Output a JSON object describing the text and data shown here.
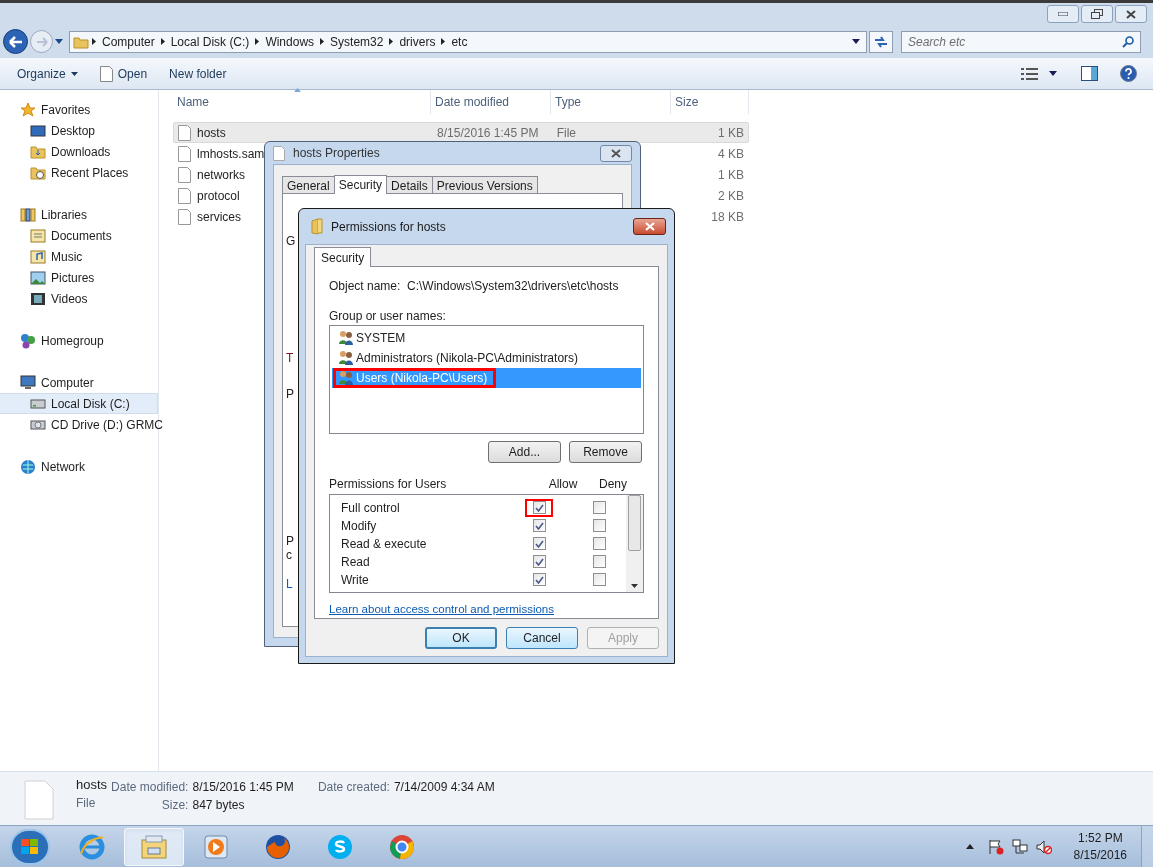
{
  "address_bar": {
    "path": [
      "Computer",
      "Local Disk (C:)",
      "Windows",
      "System32",
      "drivers",
      "etc"
    ]
  },
  "search": {
    "placeholder": "Search etc"
  },
  "toolbar": {
    "buttons": [
      {
        "label": "Organize",
        "kind": "menu"
      },
      {
        "label": "Open",
        "kind": "file"
      },
      {
        "label": "New folder",
        "kind": "plain"
      }
    ]
  },
  "sidebar": {
    "groups": [
      {
        "label": "Favorites",
        "kind": "star",
        "children": [
          {
            "label": "Desktop",
            "kind": "desktop",
            "selected": false
          },
          {
            "label": "Downloads",
            "kind": "folder",
            "selected": false
          },
          {
            "label": "Recent Places",
            "kind": "recent",
            "selected": false
          }
        ]
      },
      {
        "label": "Libraries",
        "kind": "library",
        "children": [
          {
            "label": "Documents",
            "kind": "document",
            "selected": false
          },
          {
            "label": "Music",
            "kind": "music",
            "selected": false
          },
          {
            "label": "Pictures",
            "kind": "picture",
            "selected": false
          },
          {
            "label": "Videos",
            "kind": "video",
            "selected": false
          }
        ]
      },
      {
        "label": "Homegroup",
        "kind": "homegroup"
      },
      {
        "label": "Computer",
        "kind": "computer",
        "children": [
          {
            "label": "Local Disk (C:)",
            "kind": "disk",
            "selected": true
          },
          {
            "label": "CD Drive (D:) GRMC",
            "kind": "cd",
            "selected": false
          }
        ]
      },
      {
        "label": "Network",
        "kind": "network"
      }
    ]
  },
  "file_list": {
    "columns": [
      "Name",
      "Date modified",
      "Type",
      "Size"
    ],
    "rows": [
      {
        "name": "hosts",
        "date": "8/15/2016 1:45 PM",
        "type": "File",
        "size": "1 KB",
        "selected": true
      },
      {
        "name": "lmhosts.sam",
        "size": "4 KB",
        "selected": false
      },
      {
        "name": "networks",
        "size": "1 KB",
        "selected": false
      },
      {
        "name": "protocol",
        "size": "2 KB",
        "selected": false
      },
      {
        "name": "services",
        "size": "18 KB",
        "selected": false
      }
    ]
  },
  "properties_dialog": {
    "title": "hosts Properties",
    "tabs": [
      {
        "label": "General",
        "selected": false
      },
      {
        "label": "Security",
        "selected": true
      },
      {
        "label": "Details",
        "selected": false
      },
      {
        "label": "Previous Versions",
        "selected": false
      }
    ],
    "fragments": [
      "G",
      "T",
      "P",
      "P",
      "c",
      "L"
    ]
  },
  "permissions_dialog": {
    "title": "Permissions for hosts",
    "tabs": [
      {
        "label": "Security",
        "selected": true
      }
    ],
    "object_label": "Object name:",
    "object_name": "C:\\Windows\\System32\\drivers\\etc\\hosts",
    "groups_label": "Group or user names:",
    "users": [
      {
        "name": "SYSTEM",
        "selected": false,
        "highlighted": false
      },
      {
        "name": "Administrators (Nikola-PC\\Administrators)",
        "selected": false,
        "highlighted": false
      },
      {
        "name": "Users (Nikola-PC\\Users)",
        "selected": true,
        "highlighted": true
      }
    ],
    "buttons": [
      "Add...",
      "Remove"
    ],
    "permissions_label": "Permissions for Users",
    "allow_label": "Allow",
    "deny_label": "Deny",
    "permissions": [
      {
        "name": "Full control",
        "allow": true,
        "deny": false,
        "highlighted": true
      },
      {
        "name": "Modify",
        "allow": true,
        "deny": false,
        "highlighted": false
      },
      {
        "name": "Read & execute",
        "allow": true,
        "deny": false,
        "highlighted": false
      },
      {
        "name": "Read",
        "allow": true,
        "deny": false,
        "highlighted": false
      },
      {
        "name": "Write",
        "allow": true,
        "deny": false,
        "highlighted": false
      }
    ],
    "link": "Learn about access control and permissions",
    "footer_buttons": [
      {
        "label": "OK",
        "kind": "default"
      },
      {
        "label": "Cancel",
        "kind": "normal"
      },
      {
        "label": "Apply",
        "kind": "disabled"
      }
    ]
  },
  "details_pane": {
    "name": "hosts",
    "type": "File",
    "fields": [
      {
        "label": "Date modified:",
        "value": "8/15/2016 1:45 PM"
      },
      {
        "label": "Size:",
        "value": "847 bytes"
      },
      {
        "label": "Date created:",
        "value": "7/14/2009 4:34 AM"
      }
    ]
  },
  "taskbar": {
    "apps": [
      {
        "kind": "ie",
        "selected": false
      },
      {
        "kind": "explorer",
        "selected": true
      },
      {
        "kind": "media",
        "selected": false
      },
      {
        "kind": "firefox",
        "selected": false
      },
      {
        "kind": "skype",
        "selected": false
      },
      {
        "kind": "chrome",
        "selected": false
      }
    ],
    "clock": {
      "time": "1:52 PM",
      "date": "8/15/2016"
    }
  }
}
